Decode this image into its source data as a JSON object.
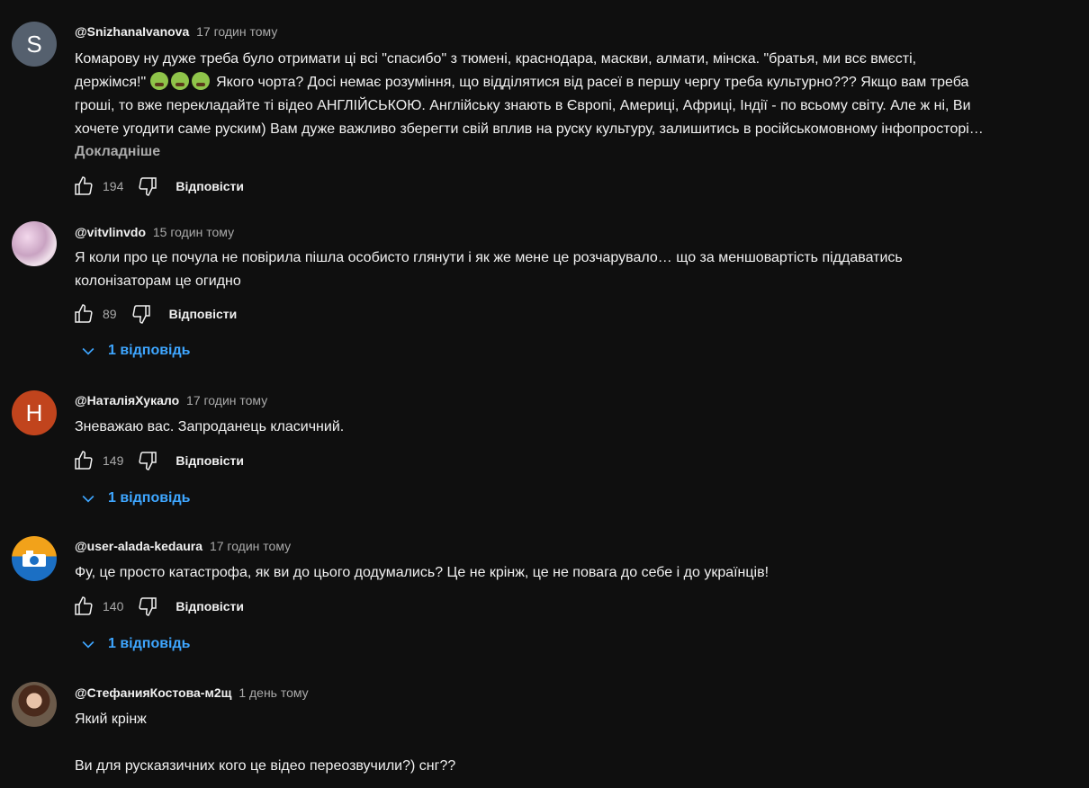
{
  "comments": [
    {
      "avatar_letter": "S",
      "avatar_color": "#55606e",
      "author": "@SnizhanaIvanova",
      "time": "17 годин тому",
      "lines": [
        "Комарову ну дуже треба було отримати ці всі \"спасибо\" з тюмені, краснодара, маскви, алмати, мінска. \"братья, ми всє вмєсті,",
        "Якого чорта? Досі немає розуміння, що відділятися від расеї в першу чергу треба культурно??? Якщо вам треба",
        "гроші, то вже перекладайте ті відео АНГЛІЙСЬКОЮ. Англійську знають в Європі, Америці, Африці, Індії - по всьому світу. Але ж ні, Ви",
        "хочете угодити саме руским) Вам дуже важливо зберегти свій вплив на руску культуру, залишитись в російськомовному інфопросторі…"
      ],
      "line2_prefix": "держімся!\"",
      "emojis": [
        "nauseated-face-emoji",
        "nauseated-face-emoji",
        "nauseated-face-emoji"
      ],
      "more_label": "Докладніше",
      "likes": "194",
      "reply_label": "Відповісти"
    },
    {
      "author": "@vitvlinvdo",
      "time": "15 годин тому",
      "lines": [
        "Я коли про це почула не повірила пішла особисто глянути і як же мене це розчарувало… що за меншовартість піддаватись",
        "колонізаторам це огидно"
      ],
      "likes": "89",
      "reply_label": "Відповісти",
      "replies_label": "1 відповідь"
    },
    {
      "avatar_letter": "Н",
      "avatar_color": "#c1441d",
      "author": "@НаталіяХукало",
      "time": "17 годин тому",
      "lines": [
        "Зневажаю вас.  Запроданець класичний."
      ],
      "likes": "149",
      "reply_label": "Відповісти",
      "replies_label": "1 відповідь"
    },
    {
      "author": "@user-alada-kedaura",
      "time": "17 годин тому",
      "lines": [
        "Фу, це просто катастрофа, як ви до цього додумались? Це не крінж, це не повага до себе і до українців!"
      ],
      "likes": "140",
      "reply_label": "Відповісти",
      "replies_label": "1 відповідь"
    },
    {
      "author": "@СтефанияКостова-м2щ",
      "time": "1 день тому",
      "lines": [
        "Який крінж",
        "",
        "Ви для рускаязичних кого це відео переозвучили?) снг??"
      ]
    }
  ]
}
